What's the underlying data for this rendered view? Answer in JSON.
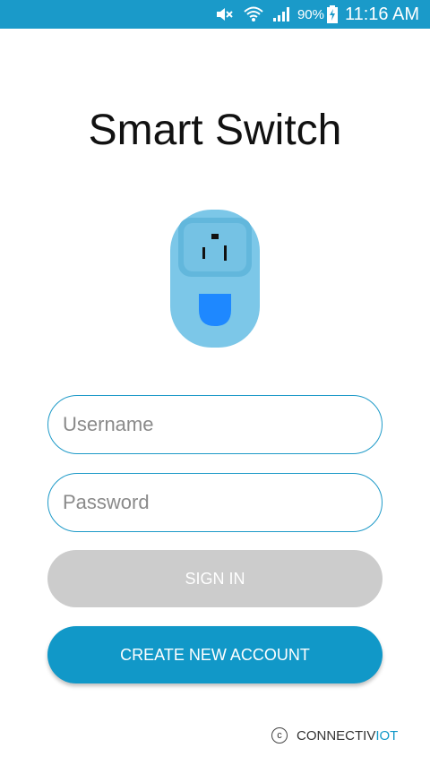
{
  "status_bar": {
    "battery_percent": "90%",
    "time": "11:16 AM",
    "icons": [
      "mute-icon",
      "wifi-icon",
      "signal-icon",
      "battery-charging-icon"
    ],
    "background_color": "#1a9ac9"
  },
  "app": {
    "title": "Smart Switch",
    "logo_icon": "smart-plug-icon"
  },
  "form": {
    "username_placeholder": "Username",
    "username_value": "",
    "password_placeholder": "Password",
    "password_value": "",
    "sign_in_label": "SIGN IN",
    "create_account_label": "CREATE NEW ACCOUNT"
  },
  "footer": {
    "copyright_symbol": "c",
    "brand_primary": "CONNECTIV",
    "brand_accent": "IOT"
  },
  "colors": {
    "accent": "#1198c8",
    "disabled_button": "#cccccc",
    "plug_body": "#7cc7e8",
    "plug_button": "#1e88ff"
  }
}
